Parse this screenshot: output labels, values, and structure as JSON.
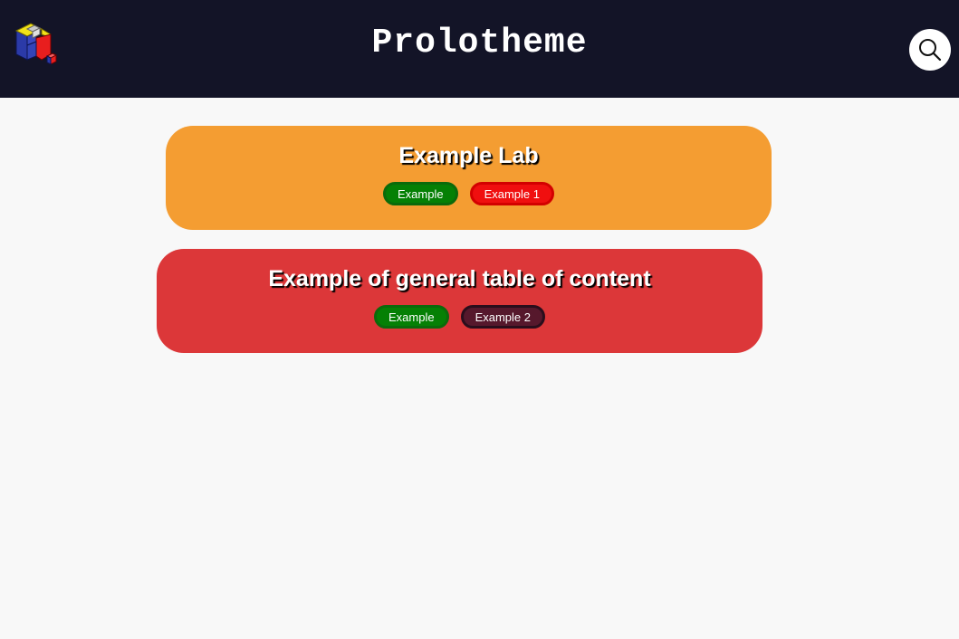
{
  "header": {
    "title": "Prolotheme",
    "logo_icon": "cube-logo-icon",
    "search_icon": "search-icon",
    "background": "#131427"
  },
  "cards": [
    {
      "title": "Example Lab",
      "color": "#f49d32",
      "tags": [
        {
          "label": "Example",
          "color": "#058005"
        },
        {
          "label": "Example 1",
          "color": "#f00f0f"
        }
      ]
    },
    {
      "title": "Example of general table of content",
      "color": "#dc3739",
      "tags": [
        {
          "label": "Example",
          "color": "#058005"
        },
        {
          "label": "Example 2",
          "color": "#56182c"
        }
      ]
    }
  ]
}
